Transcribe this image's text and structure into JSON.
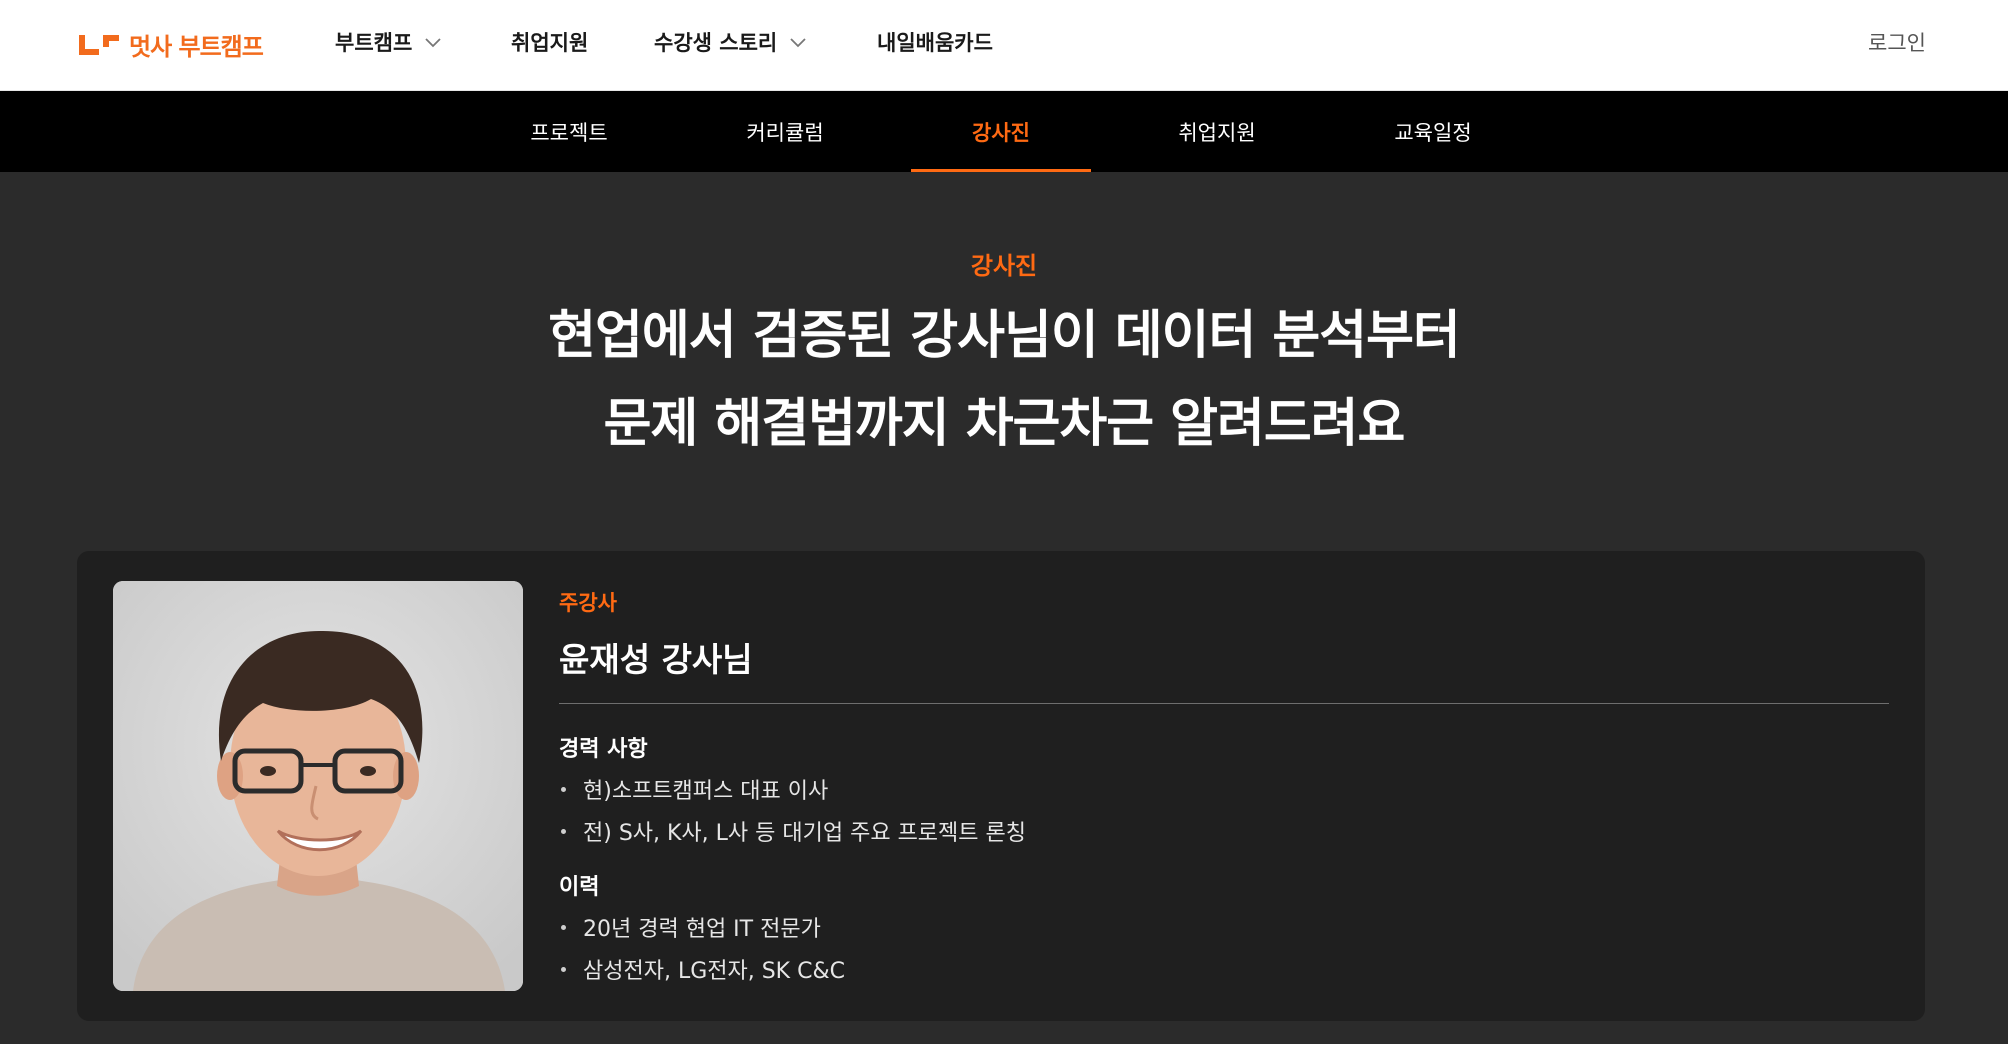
{
  "header": {
    "logo_text": "멋사 부트캠프",
    "nav": [
      {
        "label": "부트캠프",
        "has_dropdown": true
      },
      {
        "label": "취업지원",
        "has_dropdown": false
      },
      {
        "label": "수강생 스토리",
        "has_dropdown": true
      },
      {
        "label": "내일배움카드",
        "has_dropdown": false
      }
    ],
    "login_label": "로그인"
  },
  "subnav": {
    "tabs": [
      {
        "label": "프로젝트",
        "active": false
      },
      {
        "label": "커리큘럼",
        "active": false
      },
      {
        "label": "강사진",
        "active": true
      },
      {
        "label": "취업지원",
        "active": false
      },
      {
        "label": "교육일정",
        "active": false
      }
    ]
  },
  "hero": {
    "eyebrow": "강사진",
    "headline_line1": "현업에서 검증된 강사님이 데이터 분석부터",
    "headline_line2": "문제 해결법까지 차근차근 알려드려요"
  },
  "instructor": {
    "role": "주강사",
    "name": "윤재성 강사님",
    "sections": [
      {
        "title": "경력 사항",
        "items": [
          "현)소프트캠퍼스 대표 이사",
          "전) S사, K사, L사 등 대기업 주요 프로젝트 론칭"
        ]
      },
      {
        "title": "이력",
        "items": [
          "20년 경력 현업 IT 전문가",
          "삼성전자, LG전자, SK C&C"
        ]
      }
    ]
  },
  "colors": {
    "accent": "#ff6a13",
    "page_background": "#2b2b2b",
    "card_background": "#1f1f1f",
    "subnav_background": "#000000"
  }
}
